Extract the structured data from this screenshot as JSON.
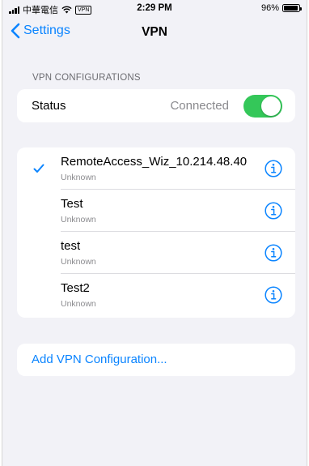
{
  "statusbar": {
    "carrier": "中華電信",
    "vpn_badge": "VPN",
    "time": "2:29 PM",
    "battery": "96%",
    "battery_level": 0.96
  },
  "nav": {
    "back_label": "Settings",
    "title": "VPN"
  },
  "section": {
    "header": "VPN CONFIGURATIONS"
  },
  "status": {
    "label": "Status",
    "value": "Connected",
    "toggle_on": true
  },
  "configurations": [
    {
      "name": "RemoteAccess_Wiz_10.214.48.40",
      "status": "Unknown",
      "selected": true
    },
    {
      "name": "Test",
      "status": "Unknown",
      "selected": false
    },
    {
      "name": "test",
      "status": "Unknown",
      "selected": false
    },
    {
      "name": "Test2",
      "status": "Unknown",
      "selected": false
    }
  ],
  "add_configuration": {
    "label": "Add VPN Configuration..."
  },
  "colors": {
    "accent": "#0a84ff",
    "toggle_on": "#34c759",
    "background": "#f2f2f7",
    "secondary_text": "#8a8a8e"
  },
  "icons": {
    "back": "chevron-left-icon",
    "checkmark": "checkmark-icon",
    "info": "info-circle-icon",
    "wifi": "wifi-icon",
    "signal": "cellular-signal-icon",
    "battery": "battery-icon"
  }
}
